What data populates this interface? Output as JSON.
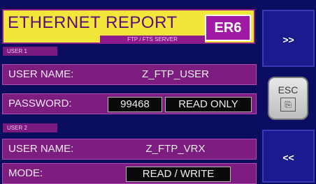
{
  "header": {
    "title": "ETHERNET REPORT",
    "subtitle": "FTP / FTS SERVER",
    "badge": "ER6"
  },
  "user1": {
    "section_label": "USER 1",
    "username_label": "USER NAME:",
    "username_value": "Z_FTP_USER",
    "password_label": "PASSWORD:",
    "password_value": "99468",
    "access_value": "READ ONLY"
  },
  "user2": {
    "section_label": "USER 2",
    "username_label": "USER NAME:",
    "username_value": "Z_FTP_VRX",
    "mode_label": "MODE:",
    "mode_value": "READ / WRITE"
  },
  "nav": {
    "next_label": ">>",
    "esc_label": "ESC",
    "esc_icon_glyph": "⎘",
    "prev_label": "<<"
  },
  "colors": {
    "background": "#0b0d63",
    "title_bar": "#f2e63a",
    "row_bg": "#7c1d7f",
    "badge": "#a11aa7"
  }
}
